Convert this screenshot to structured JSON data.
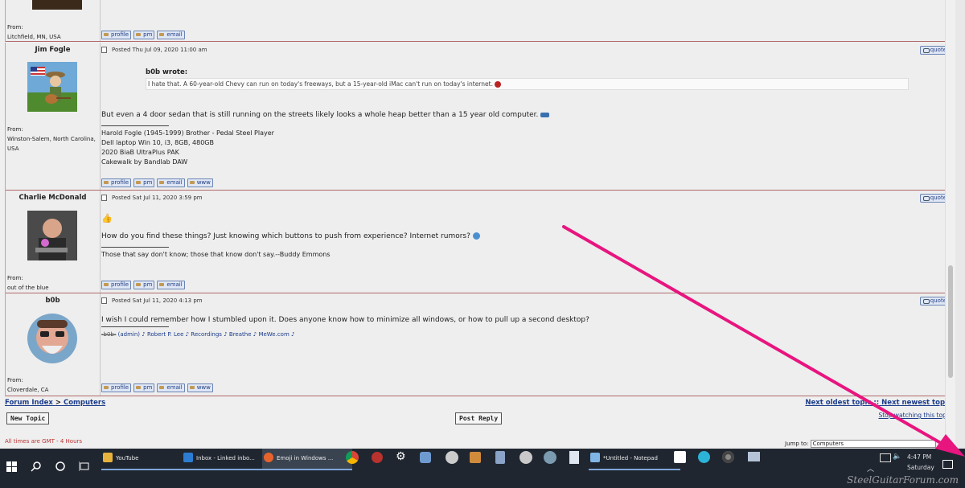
{
  "posts": [
    {
      "from_label": "From:",
      "location": "Litchfield, MN, USA",
      "buttons": [
        "profile",
        "pm",
        "email"
      ]
    },
    {
      "author": "Jim Fogle",
      "posted": "Posted Thu Jul 09, 2020 11:00 am",
      "quote_label": "quote",
      "quote_title": "b0b wrote:",
      "quote_text": "I hate that. A 60-year-old Chevy can run on today's freeways, but a 15-year-old iMac can't run on today's internet.",
      "message": "But even a 4 door sedan that is still running on the streets likely looks a whole heap better than a 15 year old computer.",
      "signature": [
        "Harold Fogle (1945-1999) Brother - Pedal Steel Player",
        "Dell laptop Win 10, i3, 8GB, 480GB",
        "2020 BiaB UltraPlus PAK",
        "Cakewalk by Bandlab DAW"
      ],
      "from_label": "From:",
      "location": "Winston-Salem, North Carolina, USA",
      "buttons": [
        "profile",
        "pm",
        "email",
        "www"
      ]
    },
    {
      "author": "Charlie McDonald",
      "posted": "Posted Sat Jul 11, 2020 3:59 pm",
      "quote_label": "quote",
      "emoji": "👍",
      "message": "How do you find these things? Just knowing which buttons to push from experience? Internet rumors?",
      "signature": [
        "Those that say don't know; those that know don't say.--Buddy Emmons"
      ],
      "from_label": "From:",
      "location": "out of the blue",
      "buttons": [
        "profile",
        "pm",
        "email"
      ]
    },
    {
      "author": "b0b",
      "posted": "Posted Sat Jul 11, 2020 4:13 pm",
      "quote_label": "quote",
      "message": "I wish I could remember how I stumbled upon it. Does anyone know how to minimize all windows, or how to pull up a second desktop?",
      "sig_name": "-b0b-",
      "sig_links": [
        "(admin)",
        "♪ Robert P. Lee",
        "♪ Recordings",
        "♪ Breathe",
        "♪ MeWe.com ♪"
      ],
      "from_label": "From:",
      "location": "Cloverdale, CA",
      "buttons": [
        "profile",
        "pm",
        "email",
        "www"
      ]
    }
  ],
  "footer": {
    "breadcrumb_index": "Forum Index",
    "breadcrumb_sep": ">",
    "breadcrumb_forum": "Computers",
    "next_oldest": "Next oldest topic",
    "nav_sep": "::",
    "next_newest": "Next newest topic",
    "stop_watching": "Stop watching this topic",
    "new_topic": "New Topic",
    "post_reply": "Post Reply",
    "timezone": "All times are GMT - 4 Hours",
    "jump_to_label": "Jump to:",
    "jump_to_value": "Computers"
  },
  "taskbar": {
    "apps": [
      "YouTube",
      "Inbox - Linked inbo...",
      "Emoji in Windows ...",
      "*Untitled - Notepad"
    ],
    "time": "4:47 PM",
    "day": "Saturday"
  },
  "watermark": "SteelGuitarForum.com",
  "colors": {
    "arrow": "#e8157f",
    "link": "#1b3c8a",
    "taskbar": "#1f2630"
  }
}
